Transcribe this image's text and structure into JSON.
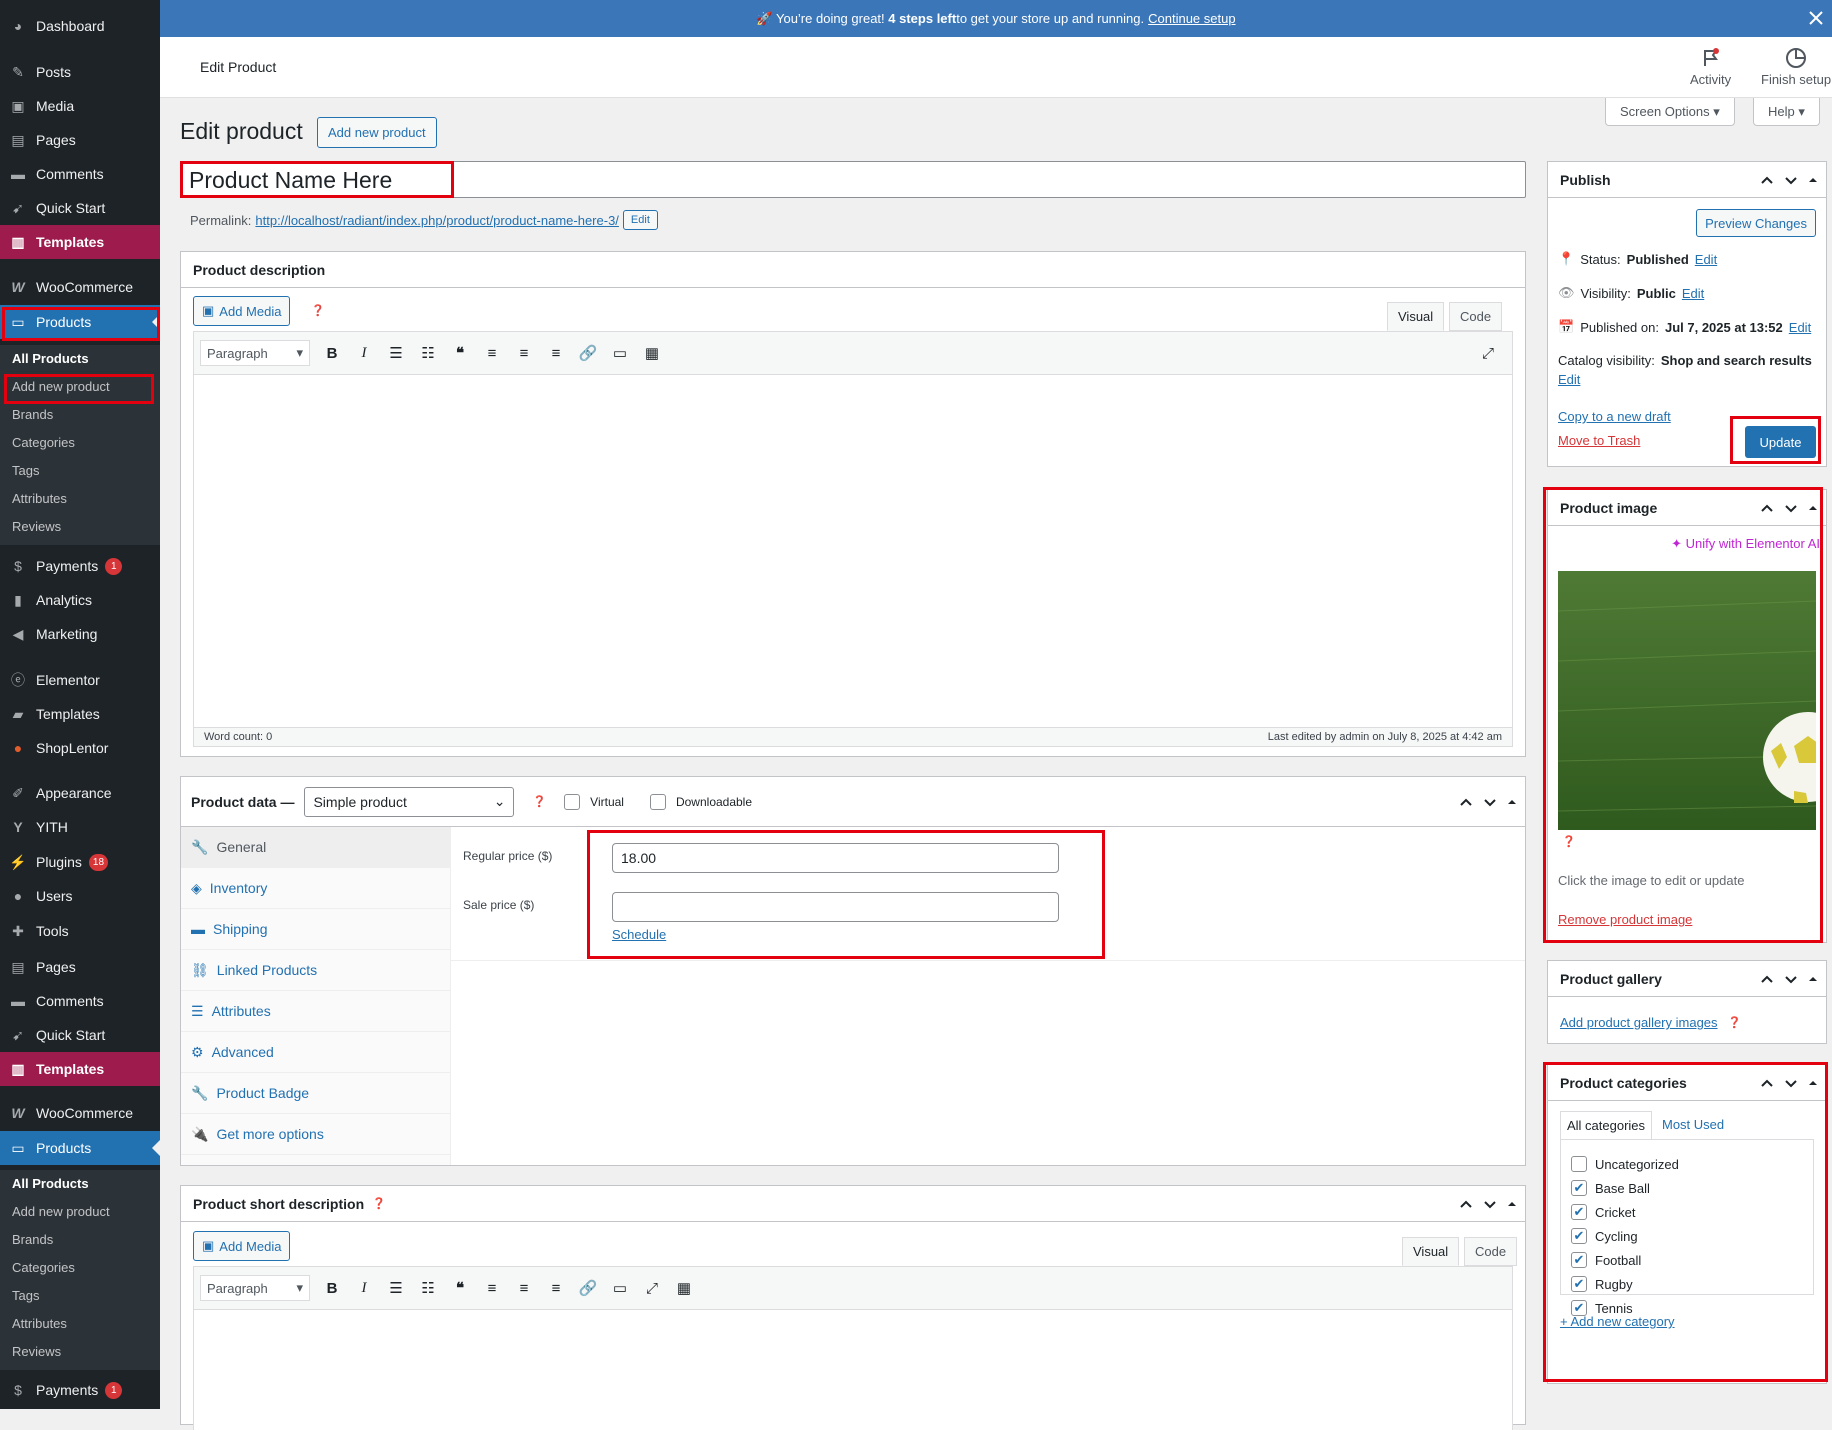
{
  "notice": {
    "text_before": "🚀 You’re doing great! ",
    "bold": "4 steps left",
    "text_after": " to get your store up and running.",
    "link": "Continue setup"
  },
  "topbar": {
    "title": "Edit Product",
    "activity": "Activity",
    "finish_setup": "Finish setup"
  },
  "screen_options": "Screen Options",
  "help": "Help",
  "page": {
    "heading": "Edit product",
    "add_new": "Add new product"
  },
  "product_title": "Product Name Here",
  "permalink": {
    "label": "Permalink:",
    "url": "http://localhost/radiant/index.php/product/product-name-here-3/",
    "edit": "Edit"
  },
  "description": {
    "title": "Product description",
    "add_media": "Add Media",
    "visual": "Visual",
    "code": "Code",
    "format": "Paragraph",
    "word_count": "Word count: 0",
    "last_edited": "Last edited by admin on July 8, 2025 at 4:42 am"
  },
  "product_data": {
    "label": "Product data —",
    "type": "Simple product",
    "virtual": "Virtual",
    "downloadable": "Downloadable",
    "tabs": [
      "General",
      "Inventory",
      "Shipping",
      "Linked Products",
      "Attributes",
      "Advanced",
      "Product Badge",
      "Get more options"
    ],
    "regular_price_label": "Regular price ($)",
    "regular_price": "18.00",
    "sale_price_label": "Sale price ($)",
    "sale_price": "",
    "schedule": "Schedule"
  },
  "short_description": {
    "title": "Product short description",
    "add_media": "Add Media",
    "visual": "Visual",
    "code": "Code",
    "format": "Paragraph"
  },
  "publish": {
    "title": "Publish",
    "preview": "Preview Changes",
    "status_label": "Status:",
    "status": "Published",
    "edit": "Edit",
    "visibility_label": "Visibility:",
    "visibility": "Public",
    "published_label": "Published on:",
    "published": "Jul 7, 2025 at 13:52",
    "catalog_label": "Catalog visibility:",
    "catalog": "Shop and search results",
    "copy_draft": "Copy to a new draft",
    "trash": "Move to Trash",
    "update": "Update"
  },
  "product_image": {
    "title": "Product image",
    "unify": "Unify with Elementor AI",
    "hint": "Click the image to edit or update",
    "remove": "Remove product image"
  },
  "gallery": {
    "title": "Product gallery",
    "add": "Add product gallery images"
  },
  "categories": {
    "title": "Product categories",
    "tab_all": "All categories",
    "tab_most": "Most Used",
    "items": [
      {
        "name": "Uncategorized",
        "checked": false
      },
      {
        "name": "Base Ball",
        "checked": true
      },
      {
        "name": "Cricket",
        "checked": true
      },
      {
        "name": "Cycling",
        "checked": true
      },
      {
        "name": "Football",
        "checked": true
      },
      {
        "name": "Rugby",
        "checked": true
      },
      {
        "name": "Tennis",
        "checked": true
      }
    ],
    "add_new": "+ Add new category"
  },
  "menu": {
    "dashboard": "Dashboard",
    "posts": "Posts",
    "media": "Media",
    "pages": "Pages",
    "comments": "Comments",
    "quick_start": "Quick Start",
    "templates": "Templates",
    "woocommerce": "WooCommerce",
    "products": "Products",
    "all_products": "All Products",
    "add_new_product": "Add new product",
    "brands": "Brands",
    "categories": "Categories",
    "tags": "Tags",
    "attributes": "Attributes",
    "reviews": "Reviews",
    "payments": "Payments",
    "payments_badge": "1",
    "analytics": "Analytics",
    "marketing": "Marketing",
    "elementor": "Elementor",
    "templates2": "Templates",
    "shoplentor": "ShopLentor",
    "appearance": "Appearance",
    "yith": "YITH",
    "plugins": "Plugins",
    "plugins_badge": "18",
    "users": "Users",
    "tools": "Tools"
  }
}
